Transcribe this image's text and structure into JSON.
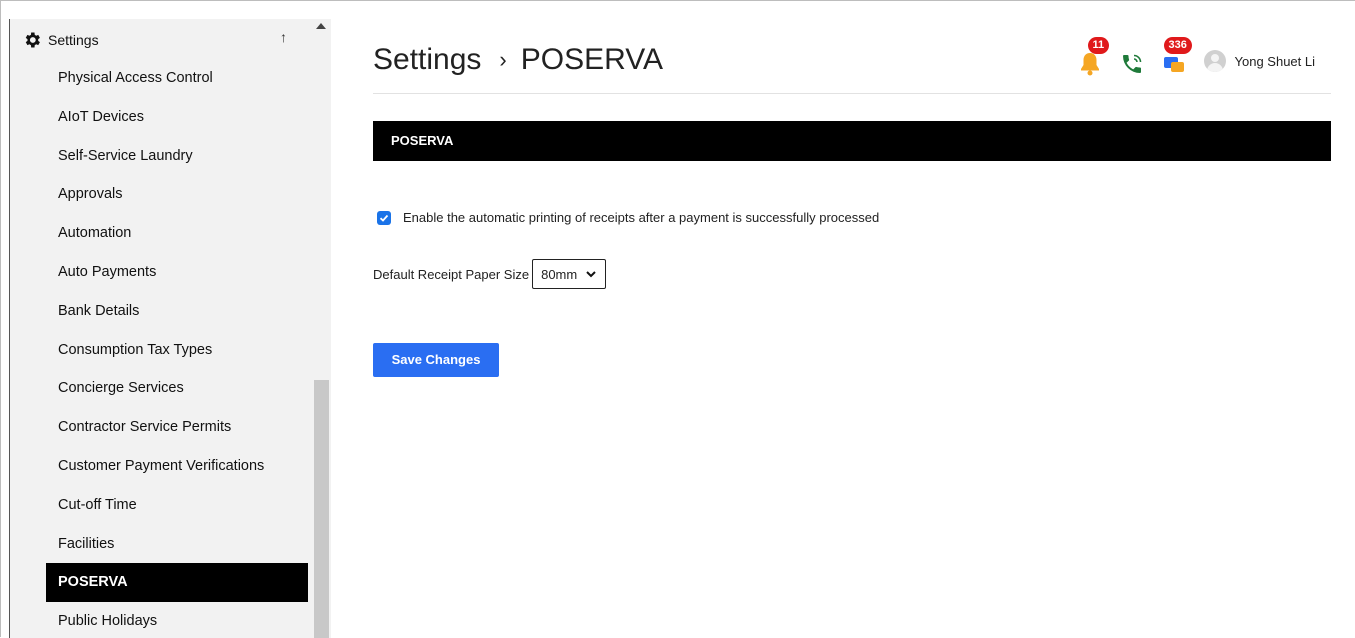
{
  "sidebar": {
    "title": "Settings",
    "up_arrow": "↑",
    "items": [
      {
        "label": "Physical Access Control"
      },
      {
        "label": "AIoT Devices"
      },
      {
        "label": "Self-Service Laundry"
      },
      {
        "label": "Approvals"
      },
      {
        "label": "Automation"
      },
      {
        "label": "Auto Payments"
      },
      {
        "label": "Bank Details"
      },
      {
        "label": "Consumption Tax Types"
      },
      {
        "label": "Concierge Services"
      },
      {
        "label": "Contractor Service Permits"
      },
      {
        "label": "Customer Payment Verifications"
      },
      {
        "label": "Cut-off Time"
      },
      {
        "label": "Facilities"
      },
      {
        "label": "POSERVA"
      },
      {
        "label": "Public Holidays"
      }
    ],
    "active_item": "POSERVA"
  },
  "header": {
    "breadcrumb_root": "Settings",
    "breadcrumb_sep": "›",
    "breadcrumb_current": "POSERVA",
    "notifications_badge": "11",
    "messages_badge": "336",
    "user_name": "Yong Shuet Li"
  },
  "section": {
    "title": "POSERVA"
  },
  "form": {
    "auto_print_label": "Enable the automatic printing of receipts after a payment is successfully processed",
    "auto_print_checked": true,
    "paper_size_label": "Default Receipt Paper Size",
    "paper_size_value": "80mm",
    "save_label": "Save Changes"
  },
  "colors": {
    "accent": "#2a6ef2",
    "active_nav_bg": "#000000",
    "badge": "#e0191b",
    "bell": "#f5a623",
    "phone": "#1f7a3a"
  }
}
